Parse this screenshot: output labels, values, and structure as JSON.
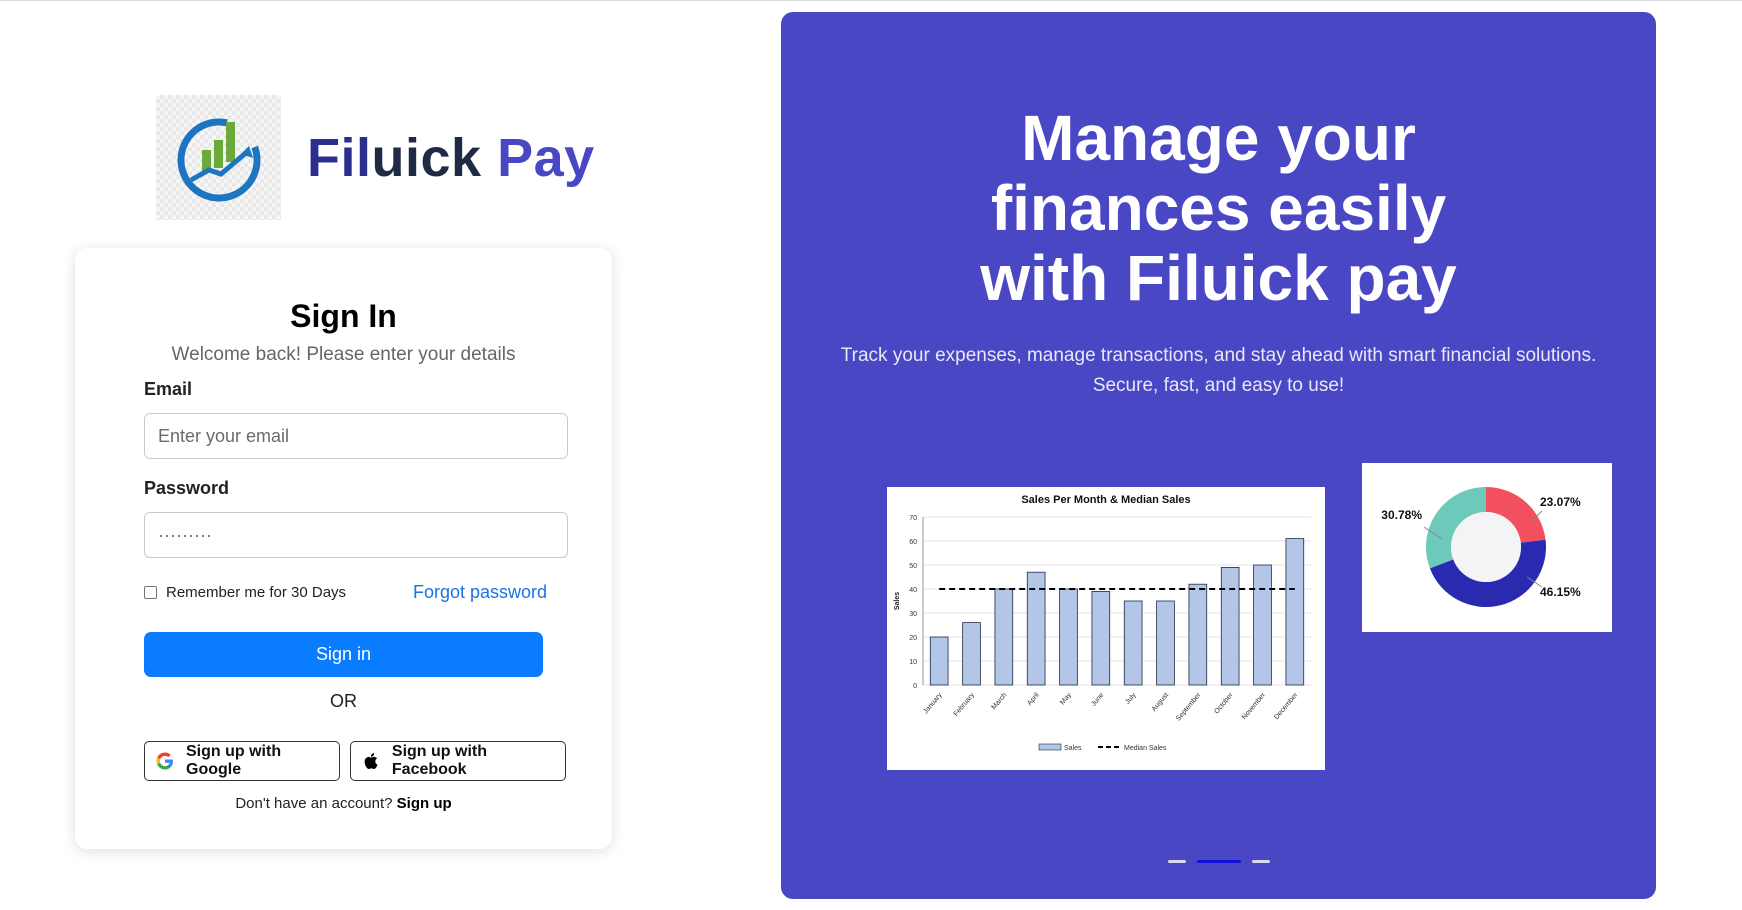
{
  "brand": {
    "name_part1": "Fil",
    "name_part2": "uick",
    "name_part3": " Pay"
  },
  "signin": {
    "title": "Sign In",
    "subtitle": "Welcome back! Please enter your details",
    "email_label": "Email",
    "email_placeholder": "Enter your email",
    "password_label": "Password",
    "password_placeholder": "·········",
    "remember_label": "Remember me for 30 Days",
    "forgot_label": "Forgot password",
    "submit_label": "Sign in",
    "or_label": "OR",
    "google_label": "Sign up with Google",
    "facebook_label": "Sign up with Facebook",
    "no_account_text": "Don't have an account? ",
    "signup_link": "Sign up"
  },
  "promo": {
    "headline": [
      "Manage your",
      "finances easily",
      "with Filuick pay"
    ],
    "description": [
      "Track your expenses, manage transactions, and stay ahead with smart financial solutions.",
      "Secure, fast, and easy to use!"
    ],
    "carousel": {
      "count": 3,
      "active_index": 1
    }
  },
  "colors": {
    "primary_button": "#0a7cff",
    "promo_bg": "#4a47c4",
    "link": "#1a73e8"
  },
  "icons": {
    "logo": "finance-growth-logo-icon",
    "google": "google-icon",
    "facebook": "apple-icon"
  },
  "chart_data": [
    {
      "type": "bar",
      "title": "Sales Per Month & Median Sales",
      "xlabel": "",
      "ylabel": "Sales",
      "ylim": [
        0,
        70
      ],
      "yticks": [
        0,
        10,
        20,
        30,
        40,
        50,
        60,
        70
      ],
      "categories": [
        "January",
        "February",
        "March",
        "April",
        "May",
        "June",
        "July",
        "August",
        "September",
        "October",
        "November",
        "December"
      ],
      "series": [
        {
          "name": "Sales",
          "values": [
            20,
            26,
            40,
            47,
            40,
            39,
            35,
            35,
            42,
            49,
            50,
            61
          ]
        },
        {
          "name": "Median Sales",
          "type": "line",
          "values": [
            40,
            40,
            40,
            40,
            40,
            40,
            40,
            40,
            40,
            40,
            40,
            40
          ]
        }
      ],
      "legend": "bottom",
      "grid": true,
      "colors": {
        "bar": "#b4c6e7",
        "median": "#000000"
      }
    },
    {
      "type": "pie",
      "labels": [
        "23.07%",
        "46.15%",
        "30.78%"
      ],
      "values": [
        23.07,
        46.15,
        30.78
      ],
      "colors": [
        "#f2505e",
        "#2a2ab0",
        "#6dc9b9"
      ],
      "donut": true
    }
  ]
}
